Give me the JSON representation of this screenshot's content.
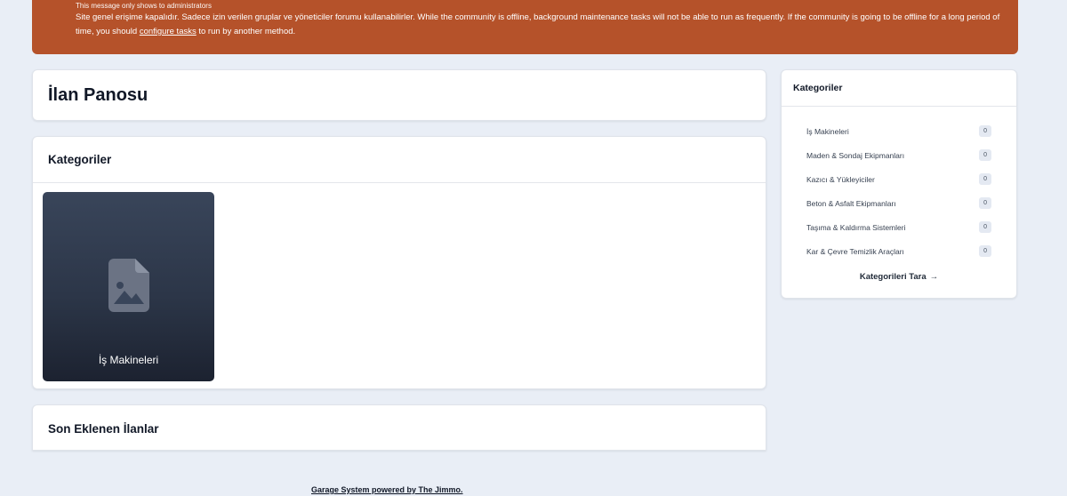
{
  "banner": {
    "admin_note": "This message only shows to administrators",
    "message_before": "Site genel erişime kapalıdır. Sadece izin verilen gruplar ve yöneticiler forumu kullanabilirler. While the community is offline, background maintenance tasks will not be able to run as frequently. If the community is going to be offline for a long period of time, you should ",
    "link_text": "configure tasks",
    "message_after": " to run by another method.",
    "color": "#b5522a"
  },
  "page": {
    "title": "İlan Panosu"
  },
  "categories_section": {
    "heading": "Kategoriler",
    "tiles": [
      {
        "label": "İş Makineleri",
        "icon": "image-file-icon"
      }
    ]
  },
  "recent_section": {
    "heading": "Son Eklenen İlanlar"
  },
  "sidebar": {
    "heading": "Kategoriler",
    "items": [
      {
        "label": "İş Makineleri",
        "count": "0"
      },
      {
        "label": "Maden & Sondaj Ekipmanları",
        "count": "0"
      },
      {
        "label": "Kazıcı & Yükleyiciler",
        "count": "0"
      },
      {
        "label": "Beton & Asfalt Ekipmanları",
        "count": "0"
      },
      {
        "label": "Taşıma & Kaldırma Sistemleri",
        "count": "0"
      },
      {
        "label": "Kar & Çevre Temizlik Araçları",
        "count": "0"
      }
    ],
    "browse_label": "Kategorileri Tara",
    "browse_icon": "arrow-right-icon"
  },
  "footer": {
    "text": "Garage System powered by The Jimmo."
  }
}
